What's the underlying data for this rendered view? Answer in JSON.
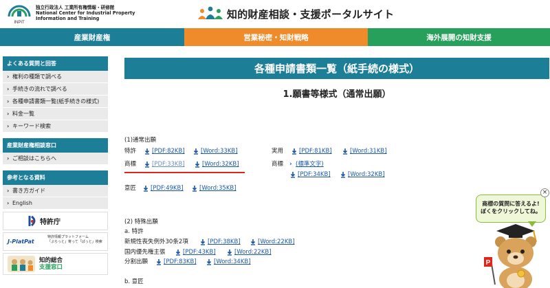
{
  "header": {
    "org_lines": [
      "独立行政法人 工業所有権情報・研修館",
      "National Center for Industrial Property",
      "Information and Training"
    ],
    "inpit_label": "INPIT",
    "portal_title": "知的財産相談・支援ポータルサイト"
  },
  "nav": {
    "ip": "産業財産権",
    "trade_secret": "営業秘密・知財戦略",
    "overseas": "海外展開の知財支援"
  },
  "sidebar": {
    "faq_title": "よくある質問と回答",
    "faq_items": [
      "権利の種類で調べる",
      "手続きの流れで調べる",
      "各種申請書類一覧(紙手続きの様式)",
      "料金一覧",
      "キーワード検索"
    ],
    "consult_title": "産業財産権相談窓口",
    "consult_items": [
      "ご相談はこちらへ"
    ],
    "ref_title": "参考となる資料",
    "ref_items": [
      "書き方ガイド",
      "English"
    ],
    "logo_jpo": "特許庁",
    "logo_jpp": "J-PlatPat",
    "logo_jpp_sub": [
      "特許情報プラットフォーム",
      "「ぷらっと」寄って「ぱっと」検索"
    ],
    "logo_sogo": [
      "知的総合",
      "支援窓口"
    ]
  },
  "main": {
    "banner": "各種申請書類一覧（紙手続の様式）",
    "subtitle": "1.願書等様式（通常出願）",
    "sec1": "(1)通常出願",
    "patent": "特許",
    "utility": "実用",
    "trademark": "商標",
    "trademark2": "商標",
    "design": "意匠",
    "standard_chars": "(標準文字)",
    "links": {
      "patent_pdf": "[PDF:82KB]",
      "patent_word": "[Word:33KB]",
      "utility_pdf": "[PDF:81KB]",
      "utility_word": "[Word:31KB]",
      "tm_pdf": "[PDF:33KB]",
      "tm_word": "[Word:32KB]",
      "tm2_pdf": "[PDF:34KB]",
      "tm2_word": "[Word:32KB]",
      "design_pdf": "[PDF:49KB]",
      "design_word": "[Word:35KB]",
      "exc_pdf": "[PDF:38KB]",
      "exc_word": "[Word:22KB]",
      "prio_pdf": "[PDF:43KB]",
      "prio_word": "[Word:22KB]",
      "div_pdf": "[PDF:83KB]",
      "div_word": "[Word:34KB]"
    },
    "sec2": "(2) 特殊出願",
    "sec2a": "a. 特許",
    "exception": "新規性喪失例外30条2項",
    "priority": "国内優先権主張",
    "divisional": "分割出願",
    "sec2b": "b. 意匠"
  },
  "mascot": {
    "bubble_lines": [
      "商標の質問に答えるよ!",
      "ぼくをクリックしてね。"
    ],
    "close": "×"
  }
}
